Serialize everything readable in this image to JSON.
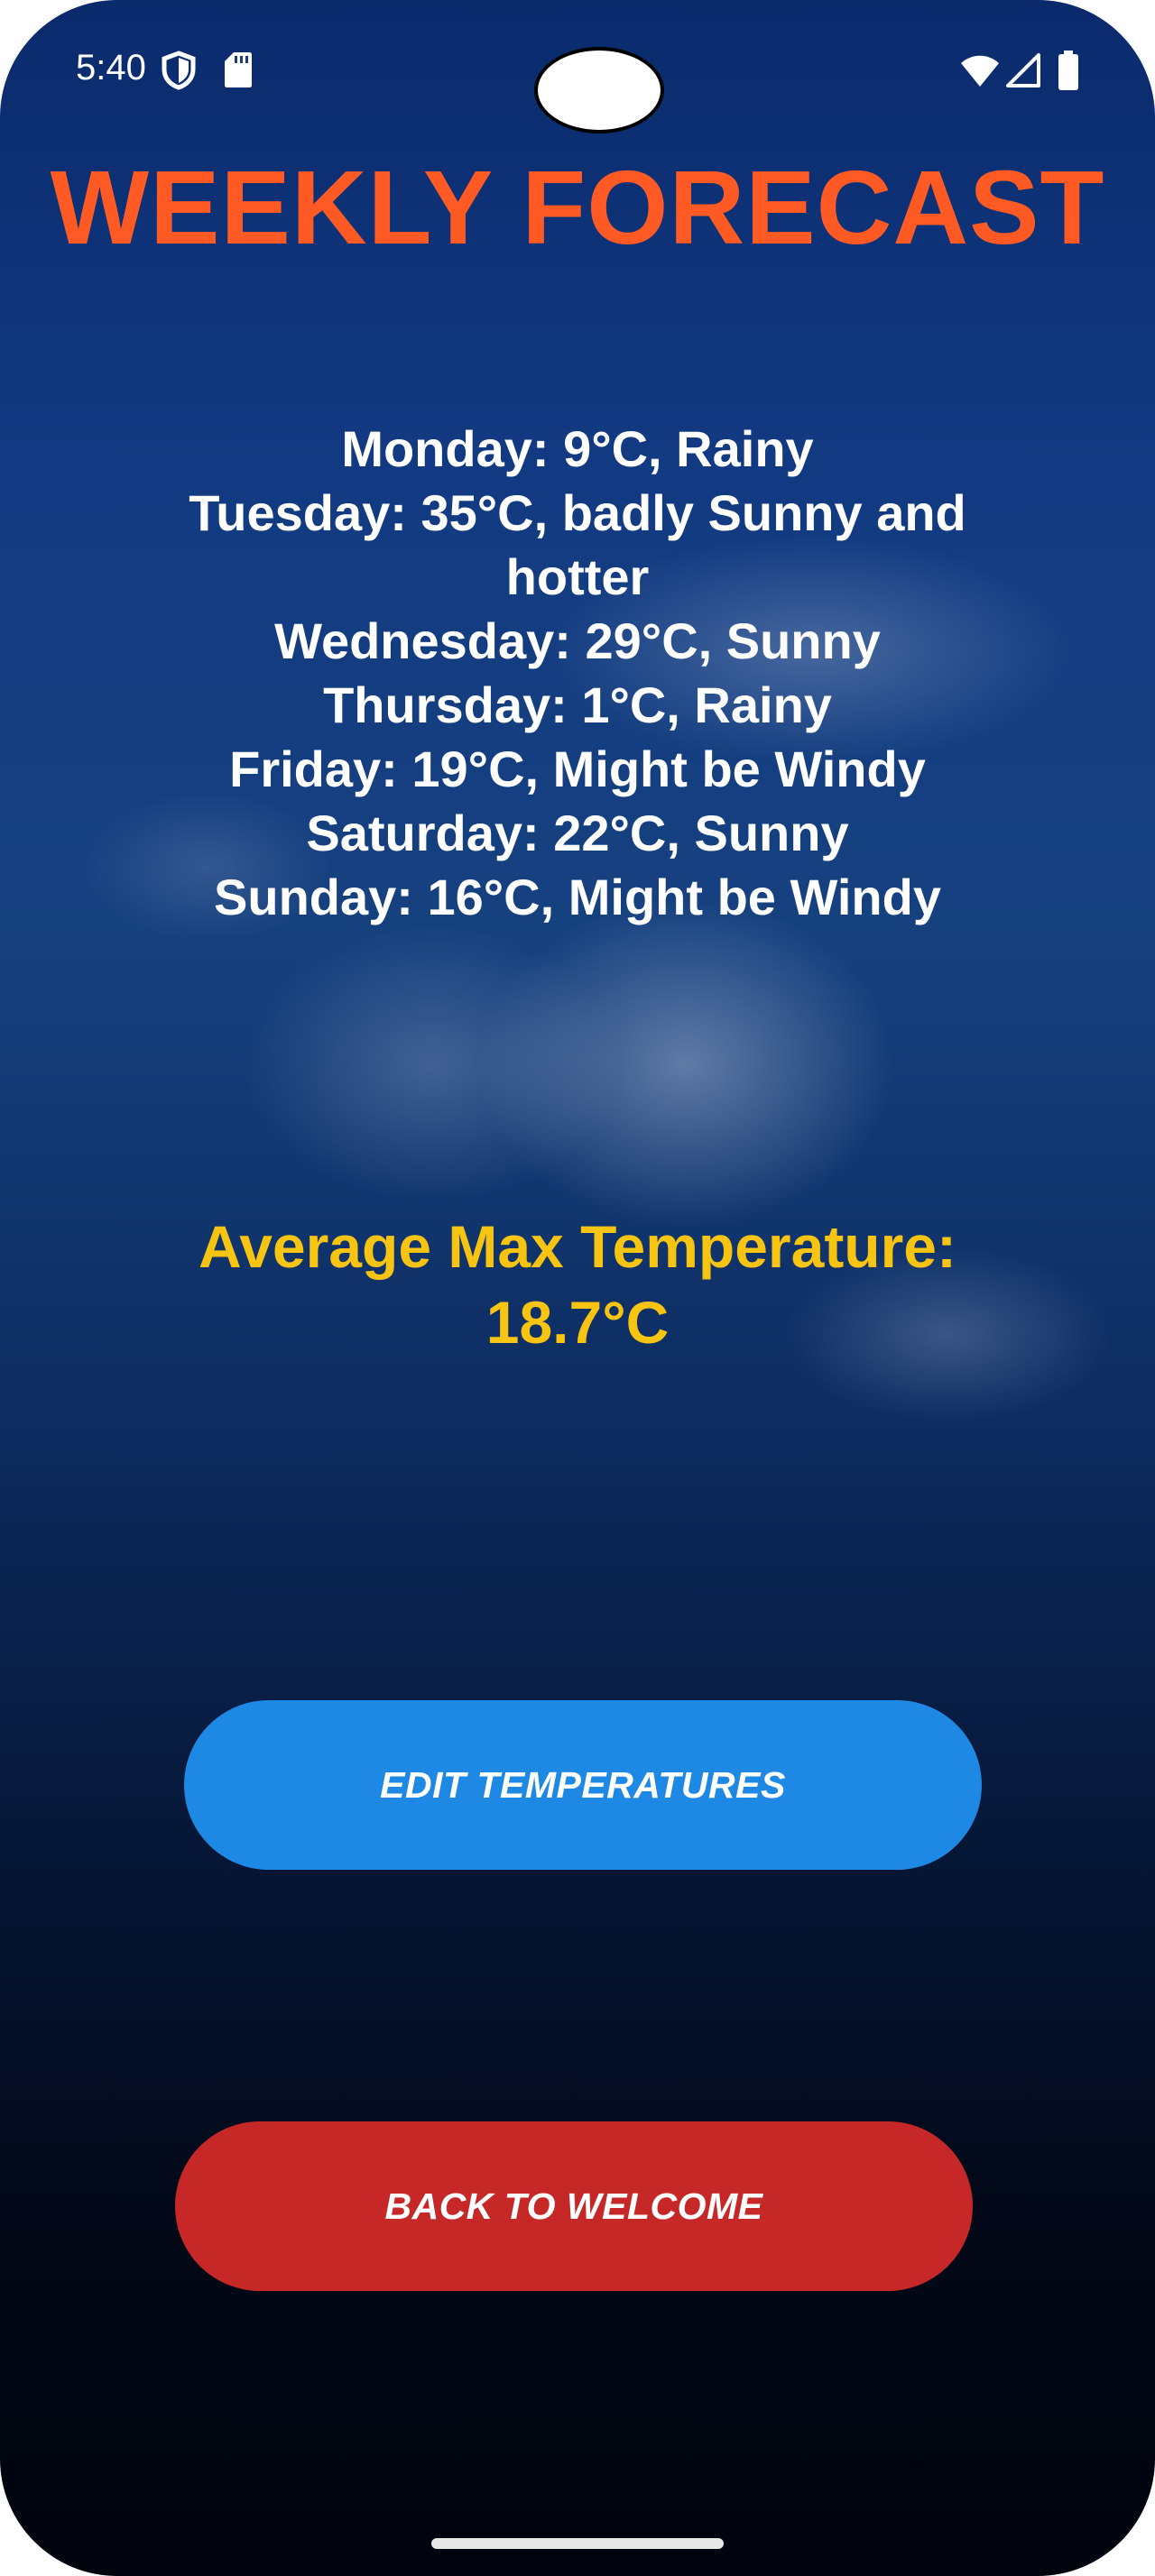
{
  "status_bar": {
    "time": "5:40",
    "icons": [
      "shield-icon",
      "sd-card-icon",
      "wifi-icon",
      "cell-signal-icon",
      "battery-icon"
    ]
  },
  "title": "WEEKLY FORECAST",
  "forecast": [
    "Monday: 9°C, Rainy",
    "Tuesday: 35°C, badly Sunny and",
    "hotter",
    "Wednesday: 29°C, Sunny",
    "Thursday: 1°C, Rainy",
    "Friday: 19°C, Might be Windy",
    "Saturday: 22°C, Sunny",
    "Sunday: 16°C, Might be Windy"
  ],
  "average": {
    "label": "Average Max Temperature:",
    "value": "18.7°C"
  },
  "buttons": {
    "edit": "EDIT TEMPERATURES",
    "back": "BACK TO WELCOME"
  },
  "colors": {
    "title": "#ff5a24",
    "average_text": "#f7c412",
    "edit_button": "#1e88e5",
    "back_button": "#c62828",
    "forecast_text": "#ffffff"
  }
}
